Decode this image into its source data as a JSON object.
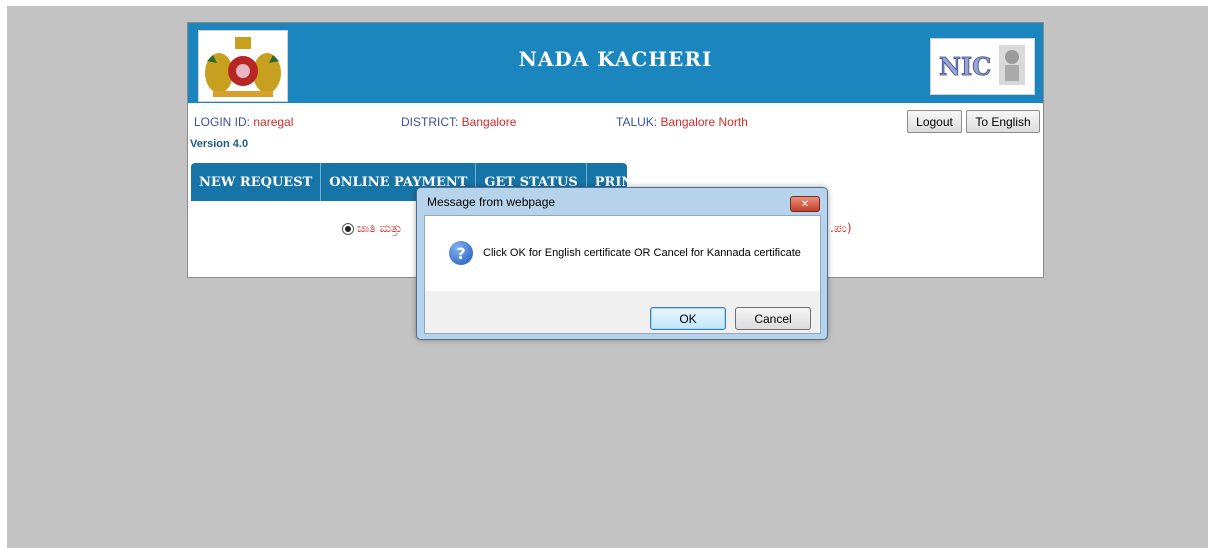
{
  "header": {
    "title": "NADA KACHERI"
  },
  "info": {
    "login_label": "LOGIN ID: ",
    "login_value": "naregal",
    "district_label": "DISTRICT: ",
    "district_value": "Bangalore",
    "taluk_label": "TALUK: ",
    "taluk_value": "Bangalore North",
    "version": "Version 4.0"
  },
  "buttons": {
    "logout": "Logout",
    "to_english": "To English"
  },
  "menu": {
    "items": [
      {
        "label": "NEW REQUEST"
      },
      {
        "label": "ONLINE PAYMENT"
      },
      {
        "label": "GET STATUS"
      },
      {
        "label": "PRINT"
      }
    ]
  },
  "form": {
    "radio_label_visible": "ಜಾತಿ ಮತ್ತು",
    "radio_tail_visible": ".ಪಂ)"
  },
  "dialog": {
    "title": "Message from webpage",
    "message": "Click OK for English certificate OR  Cancel for Kannada certificate",
    "ok_label": "OK",
    "cancel_label": "Cancel",
    "close_glyph": "✕"
  },
  "colors": {
    "banner": "#1b86bd",
    "menu": "#1774a6",
    "value_red": "#d42a2a",
    "label_blue": "#3b4f9a",
    "page_bg": "#c3c3c3"
  },
  "icons": {
    "emblem": "karnataka-emblem-icon",
    "nic": "nic-logo-icon",
    "question": "question-icon"
  }
}
